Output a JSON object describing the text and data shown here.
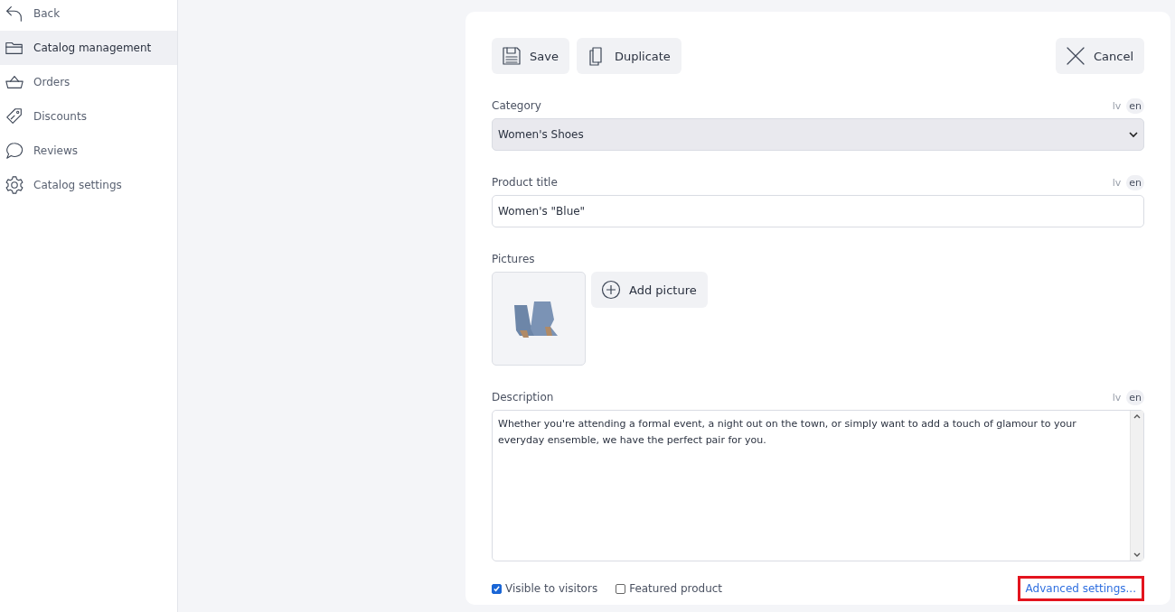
{
  "sidebar": {
    "items": [
      {
        "kind": "back",
        "label": "Back",
        "selected": false
      },
      {
        "kind": "folder",
        "label": "Catalog management",
        "selected": true
      },
      {
        "kind": "basket",
        "label": "Orders",
        "selected": false
      },
      {
        "kind": "tag",
        "label": "Discounts",
        "selected": false
      },
      {
        "kind": "bubble",
        "label": "Reviews",
        "selected": false
      },
      {
        "kind": "gear",
        "label": "Catalog settings",
        "selected": false
      }
    ]
  },
  "toolbar": {
    "left": [
      {
        "kind": "save",
        "label": "Save"
      },
      {
        "kind": "duplicate",
        "label": "Duplicate"
      }
    ],
    "right": [
      {
        "kind": "cancel",
        "label": "Cancel"
      }
    ]
  },
  "fields": [
    {
      "kind": "select",
      "label": "Category",
      "value": "Women's Shoes",
      "languages": [
        {
          "label": "lv",
          "selected": false
        },
        {
          "label": "en",
          "selected": true
        }
      ]
    },
    {
      "kind": "text",
      "label": "Product title",
      "value": "Women's \"Blue\"",
      "languages": [
        {
          "label": "lv",
          "selected": false
        },
        {
          "label": "en",
          "selected": true
        }
      ]
    },
    {
      "kind": "pictures",
      "label": "Pictures",
      "add_label": "Add picture"
    },
    {
      "kind": "textarea",
      "label": "Description",
      "value": "Whether you're attending a formal event, a night out on the town, or simply want to add a touch of glamour to your everyday ensemble, we have the perfect pair for you.",
      "languages": [
        {
          "label": "lv",
          "selected": false
        },
        {
          "label": "en",
          "selected": true
        }
      ]
    }
  ],
  "options": [
    {
      "label": "Visible to visitors",
      "checked": true
    },
    {
      "label": "Featured product",
      "checked": false
    }
  ],
  "advanced_link": {
    "label": "Advanced settings...",
    "highlighted": true
  }
}
